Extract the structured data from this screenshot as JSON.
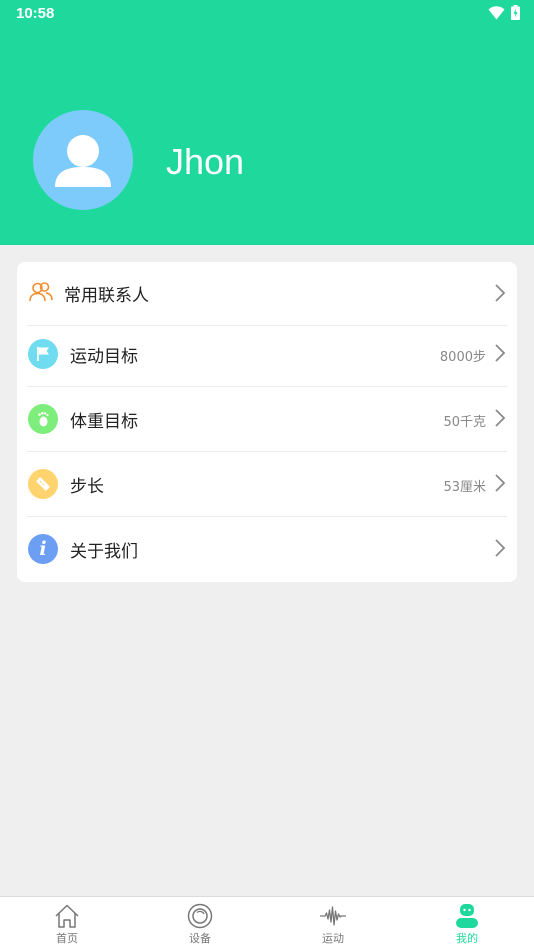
{
  "status_bar": {
    "time": "10:58",
    "icons": [
      "wifi-icon",
      "battery-charging-icon"
    ]
  },
  "profile": {
    "name": "Jhon",
    "avatar_icon": "user-avatar-icon"
  },
  "colors": {
    "accent": "#1ed99b",
    "avatar_bg": "#7dcbfa"
  },
  "menu": [
    {
      "label": "常用联系人",
      "value": "",
      "icon": "contacts-icon",
      "icon_color": "#f0902f"
    },
    {
      "label": "运动目标",
      "value": "8000步",
      "icon": "flag-icon",
      "icon_color": "#6fdcf0"
    },
    {
      "label": "体重目标",
      "value": "50千克",
      "icon": "foot-icon",
      "icon_color": "#7ded7c"
    },
    {
      "label": "步长",
      "value": "53厘米",
      "icon": "ruler-icon",
      "icon_color": "#ffd36d"
    },
    {
      "label": "关于我们",
      "value": "",
      "icon": "info-icon",
      "icon_color": "#6c9ff4"
    }
  ],
  "tabs": [
    {
      "label": "首页",
      "icon": "home-icon",
      "active": false
    },
    {
      "label": "设备",
      "icon": "device-icon",
      "active": false
    },
    {
      "label": "运动",
      "icon": "waveform-icon",
      "active": false
    },
    {
      "label": "我的",
      "icon": "robot-profile-icon",
      "active": true
    }
  ]
}
